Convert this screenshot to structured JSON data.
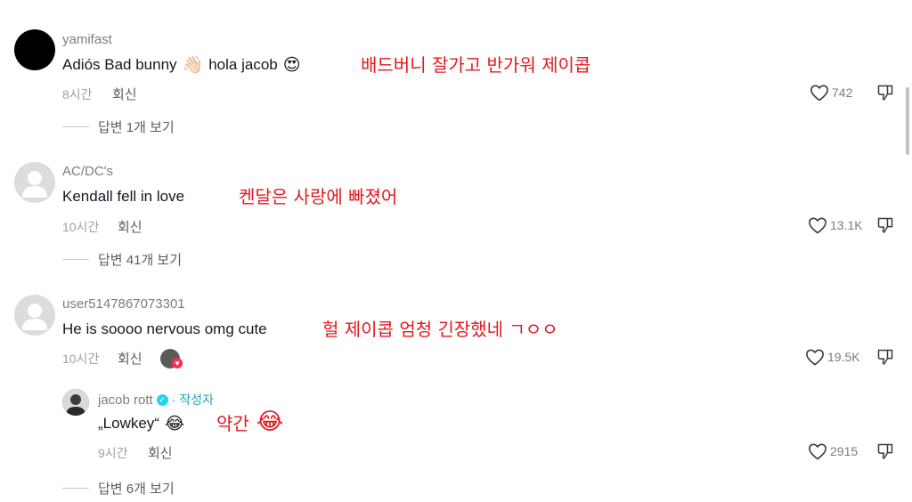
{
  "comments": [
    {
      "username": "yamifast",
      "text": "Adiós Bad bunny",
      "emoji1": "👋🏻",
      "text2": "hola jacob",
      "emoji2": "😍",
      "translation": "배드버니 잘가고 반가워 제이콥",
      "time": "8시간",
      "reply_label": "회신",
      "likes": "742",
      "view_replies": "답변 1개 보기"
    },
    {
      "username": "AC/DC's",
      "text": "Kendall fell in love",
      "translation": "켄달은 사랑에 빠졌어",
      "time": "10시간",
      "reply_label": "회신",
      "likes": "13.1K",
      "view_replies": "답변 41개 보기"
    },
    {
      "username": "user5147867073301",
      "text": "He is soooo nervous omg cute",
      "translation": "헐 제이콥 엄청 긴장했네 ㄱㅇㅇ",
      "time": "10시간",
      "reply_label": "회신",
      "likes": "19.5K",
      "view_replies": "답변 6개 보기"
    }
  ],
  "author_reply": {
    "username": "jacob rott",
    "separator": "·",
    "author_tag": "작성자",
    "text": "„Lowkey“",
    "emoji": "😂",
    "translation": "약간",
    "translation_emoji": "😂",
    "time": "9시간",
    "reply_label": "회신",
    "likes": "2915"
  },
  "colors": {
    "translation": "#e0191f",
    "verified": "#20d5ec",
    "heart": "#fe2c55"
  },
  "icons": {
    "like": "heart-outline-icon",
    "dislike": "thumbs-down-icon"
  }
}
